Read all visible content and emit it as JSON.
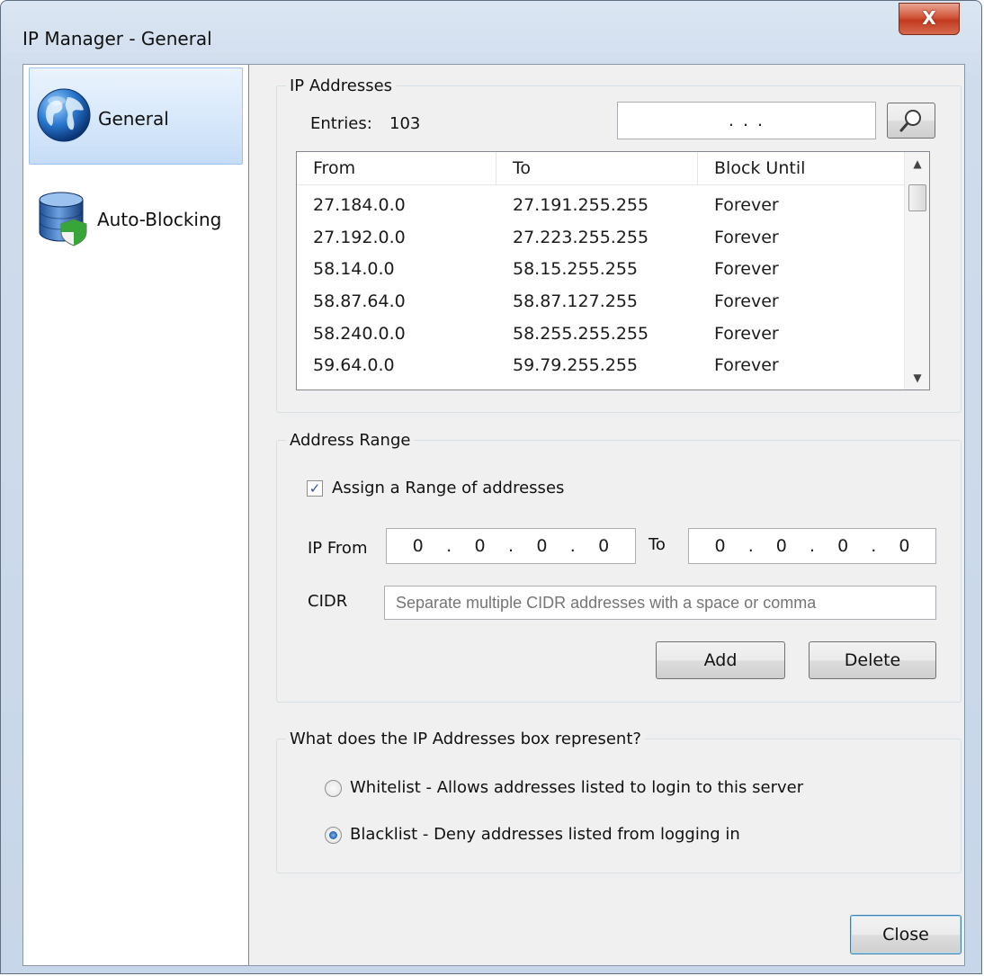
{
  "window": {
    "title": "IP Manager - General",
    "close_glyph": "X"
  },
  "sidebar": {
    "items": [
      {
        "label": "General",
        "icon": "globe-icon",
        "selected": true
      },
      {
        "label": "Auto-Blocking",
        "icon": "database-shield-icon",
        "selected": false
      }
    ]
  },
  "ip_addresses": {
    "legend": "IP Addresses",
    "entries_label": "Entries:",
    "entries_count": "103",
    "search_value": ".    .    .",
    "search_icon": "magnifier-icon",
    "columns": [
      "From",
      "To",
      "Block Until"
    ],
    "rows": [
      {
        "from": "27.184.0.0",
        "to": "27.191.255.255",
        "until": "Forever"
      },
      {
        "from": "27.192.0.0",
        "to": "27.223.255.255",
        "until": "Forever"
      },
      {
        "from": "58.14.0.0",
        "to": "58.15.255.255",
        "until": "Forever"
      },
      {
        "from": "58.87.64.0",
        "to": "58.87.127.255",
        "until": "Forever"
      },
      {
        "from": "58.240.0.0",
        "to": "58.255.255.255",
        "until": "Forever"
      },
      {
        "from": "59.64.0.0",
        "to": "59.79.255.255",
        "until": "Forever"
      }
    ]
  },
  "address_range": {
    "legend": "Address Range",
    "assign_range_label": "Assign a Range of addresses",
    "assign_range_checked": true,
    "ip_from_label": "IP From",
    "ip_from_octets": [
      "0",
      ".",
      "0",
      ".",
      "0",
      ".",
      "0"
    ],
    "to_label": "To",
    "ip_to_octets": [
      "0",
      ".",
      "0",
      ".",
      "0",
      ".",
      "0"
    ],
    "cidr_label": "CIDR",
    "cidr_placeholder": "Separate multiple CIDR addresses with a space or comma",
    "add_label": "Add",
    "delete_label": "Delete"
  },
  "represent": {
    "legend": "What does the IP Addresses box represent?",
    "whitelist_label": "Whitelist - Allows addresses listed to login to this server",
    "blacklist_label": "Blacklist - Deny addresses listed from logging in",
    "selected": "blacklist"
  },
  "footer": {
    "close_label": "Close"
  },
  "colors": {
    "selection_bg": "#d9e9fb",
    "title_close_red": "#c23a1f",
    "radio_dot_blue": "#1f5fb4"
  }
}
